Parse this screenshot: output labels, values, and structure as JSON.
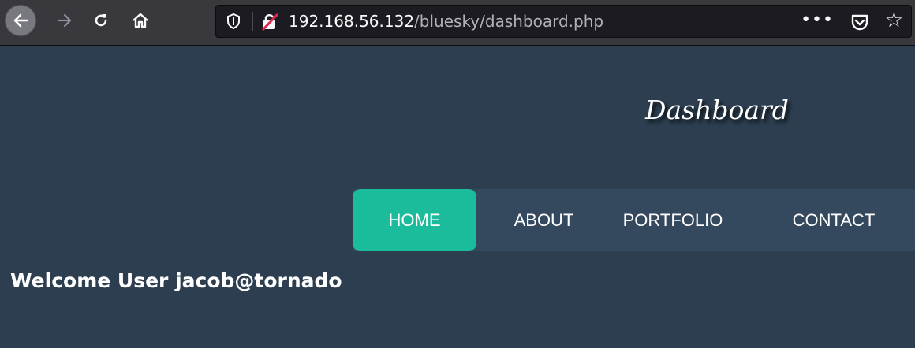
{
  "browser": {
    "url_host": "192.168.56.132",
    "url_path": "/bluesky/dashboard.php",
    "more_label": "•••"
  },
  "page": {
    "title": "Dashboard",
    "menu": [
      {
        "label": "HOME",
        "active": true
      },
      {
        "label": "ABOUT",
        "active": false
      },
      {
        "label": "PORTFOLIO",
        "active": false
      },
      {
        "label": "CONTACT",
        "active": false
      }
    ],
    "welcome": "Welcome User jacob@tornado"
  },
  "colors": {
    "page_bg": "#2c3e50",
    "menu_bg": "#34495e",
    "active_bg": "#1abc9c"
  }
}
